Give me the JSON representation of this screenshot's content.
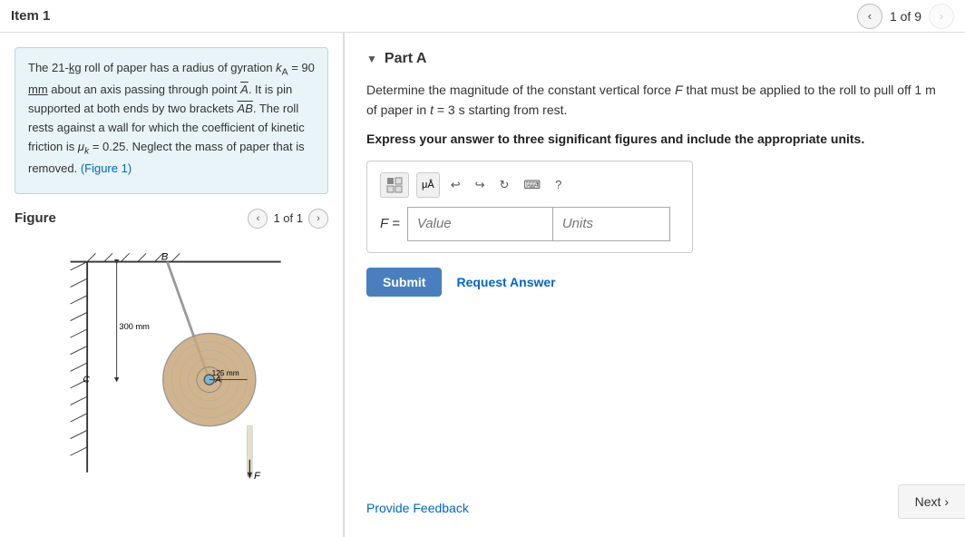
{
  "topbar": {
    "item_label": "Item 1",
    "nav_prev": "‹",
    "nav_next": "›",
    "page_info": "1 of 9"
  },
  "left": {
    "problem_text_1": "The 21-kg roll of paper has a radius of gyration",
    "problem_math": "k",
    "problem_subscript": "A",
    "problem_text_2": "= 90 mm about an axis passing through point",
    "problem_point": "A",
    "problem_text_3": ". It is pin supported at both ends by two brackets",
    "problem_brackets": "AB",
    "problem_text_4": ". The roll rests against a wall for which the coefficient of kinetic friction is",
    "problem_mu": "μ",
    "problem_mu_sub": "k",
    "problem_mu_val": "= 0.25. Neglect the mass of paper that is removed.",
    "problem_link": "(Figure 1)",
    "figure_title": "Figure",
    "figure_page": "1 of 1",
    "dimension_300": "300 mm",
    "dimension_125": "125 mm",
    "label_B": "B",
    "label_C": "C",
    "label_A": "A",
    "label_F": "F"
  },
  "right": {
    "part_label": "Part A",
    "problem_statement": "Determine the magnitude of the constant vertical force",
    "force_symbol": "F",
    "problem_statement_2": "that must be applied to the roll to pull off 1 m of paper in t = 3 s starting from rest.",
    "units_instruction": "Express your answer to three significant figures and include the appropriate units.",
    "value_placeholder": "Value",
    "units_placeholder": "Units",
    "f_equals": "F =",
    "submit_label": "Submit",
    "request_label": "Request Answer",
    "feedback_label": "Provide Feedback",
    "next_label": "Next ›"
  },
  "toolbar": {
    "matrix_icon": "⊞",
    "mu_icon": "μÅ",
    "undo_icon": "↩",
    "redo_icon": "↪",
    "refresh_icon": "↻",
    "keyboard_icon": "⌨",
    "help_icon": "?"
  }
}
